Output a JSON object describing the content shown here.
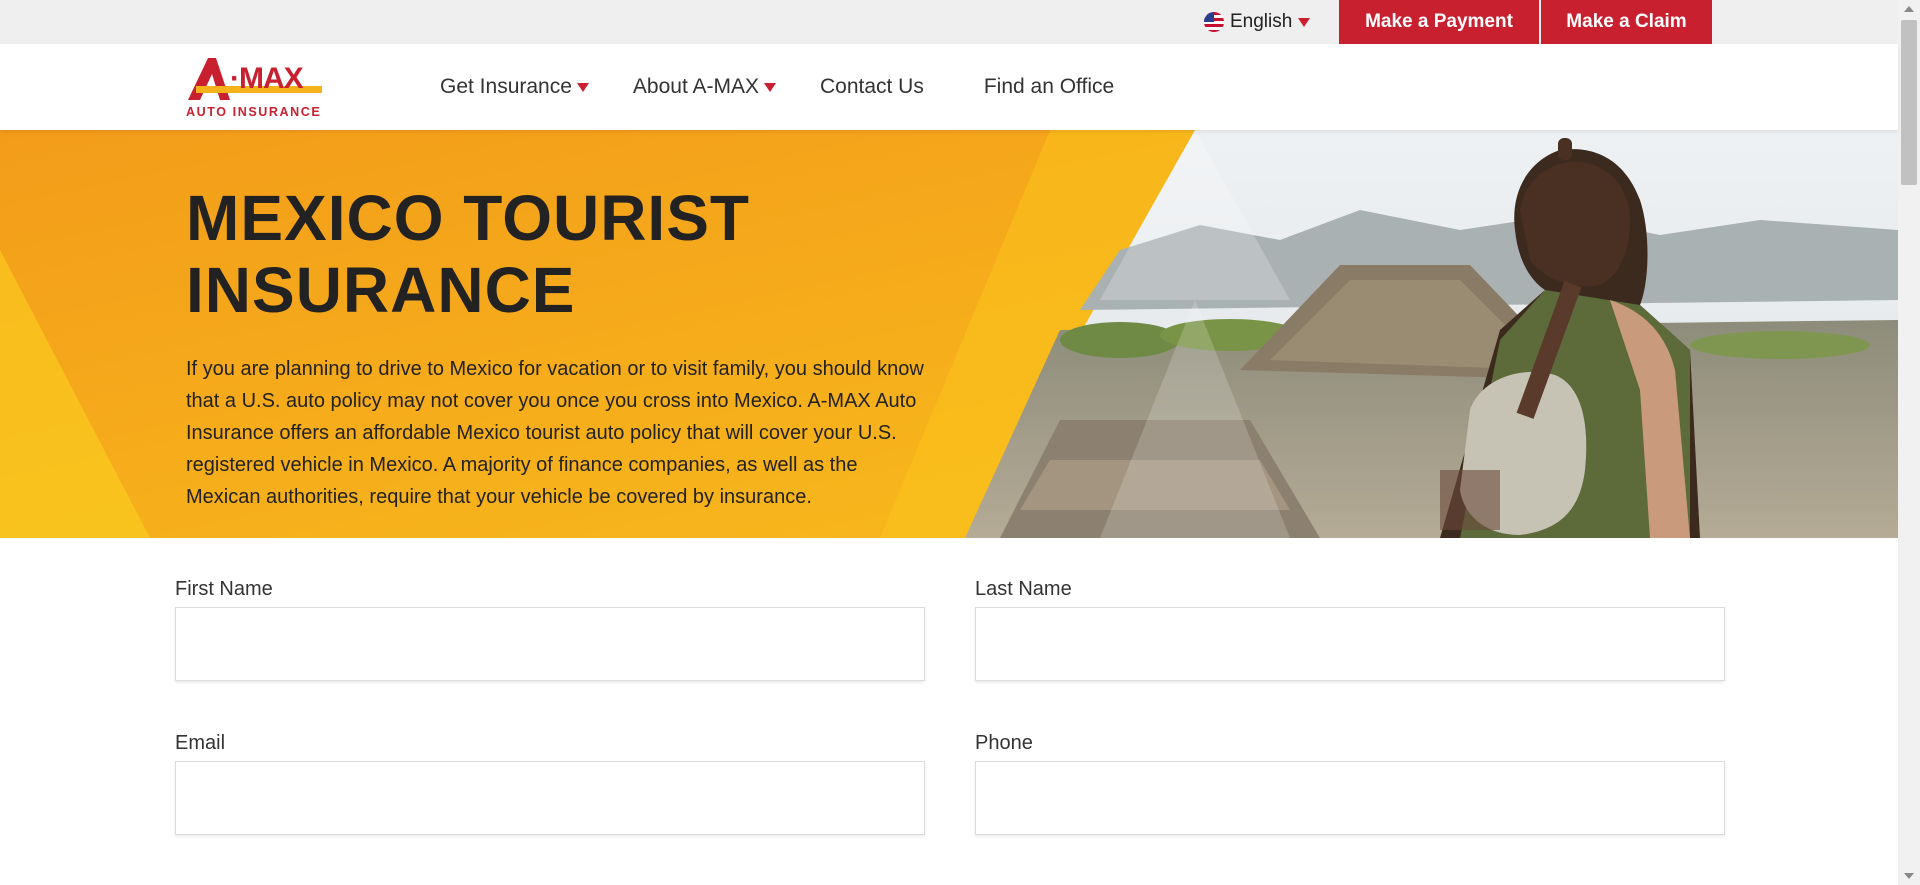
{
  "topbar": {
    "language": "English",
    "language_icon": "us-flag-icon",
    "make_payment": "Make a Payment",
    "make_claim": "Make a Claim"
  },
  "logo": {
    "brand": "A-MAX",
    "tagline": "AUTO INSURANCE"
  },
  "nav": {
    "items": [
      {
        "label": "Get Insurance",
        "dropdown": true
      },
      {
        "label": "About A-MAX",
        "dropdown": true
      },
      {
        "label": "Contact Us",
        "dropdown": false
      },
      {
        "label": "Find an Office",
        "dropdown": false
      }
    ]
  },
  "hero": {
    "title_line1": "MEXICO TOURIST",
    "title_line2": "INSURANCE",
    "text": "If you are planning to drive to Mexico for vacation or to visit family, you should know that a U.S. auto policy may not cover you once you cross into Mexico. A-MAX Auto Insurance offers an affordable Mexico tourist auto policy that will cover your U.S. registered vehicle in Mexico. A majority of finance companies, as well as the Mexican authorities, require that your vehicle be covered by insurance."
  },
  "form": {
    "first_name_label": "First Name",
    "first_name_value": "",
    "last_name_label": "Last Name",
    "last_name_value": "",
    "email_label": "Email",
    "email_value": "",
    "phone_label": "Phone",
    "phone_value": ""
  },
  "colors": {
    "brand_red": "#c8202f",
    "hero_yellow": "#f6b21b",
    "hero_orange": "#f39c1a"
  }
}
